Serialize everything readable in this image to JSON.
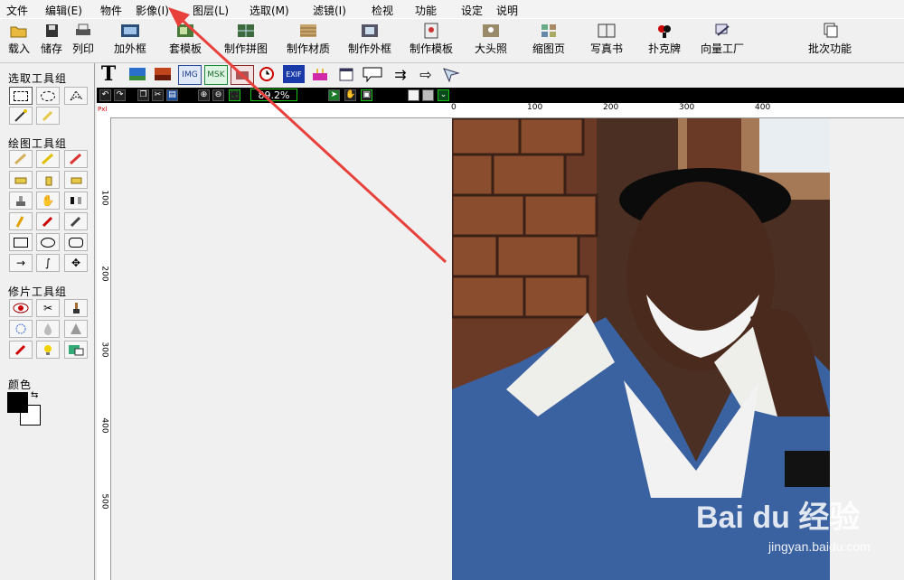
{
  "menu": [
    "文件",
    "编辑(E)",
    "物件",
    "影像(I)",
    "图层(L)",
    "选取(M)",
    "滤镜(I)",
    "检视",
    "功能",
    "设定",
    "说明"
  ],
  "toolbar": [
    "载入",
    "储存",
    "列印",
    "加外框",
    "套模板",
    "制作拼图",
    "制作材质",
    "制作外框",
    "制作模板",
    "大头照",
    "缩图页",
    "写真书",
    "扑克牌",
    "向量工厂",
    "批次功能"
  ],
  "panel": {
    "select_group": "选取工具组",
    "draw_group": "绘图工具组",
    "retouch_group": "修片工具组",
    "color_label": "颜色"
  },
  "fx": {
    "text_tool": "T",
    "img": "IMG",
    "msk": "MSK",
    "exif": "EXIF"
  },
  "nav": {
    "zoom": "89.2%",
    "page": "Pxl"
  },
  "ruler": {
    "h_ticks": [
      "0",
      "100",
      "200",
      "300",
      "400"
    ],
    "v_ticks": [
      "100",
      "200",
      "300",
      "400",
      "500"
    ]
  },
  "watermark": {
    "brand": "Bai du 经验",
    "site": "jingyan.baidu.com"
  },
  "colors": {
    "accent_arrow": "#e8413c",
    "foreground": "#000000",
    "background": "#ffffff"
  }
}
